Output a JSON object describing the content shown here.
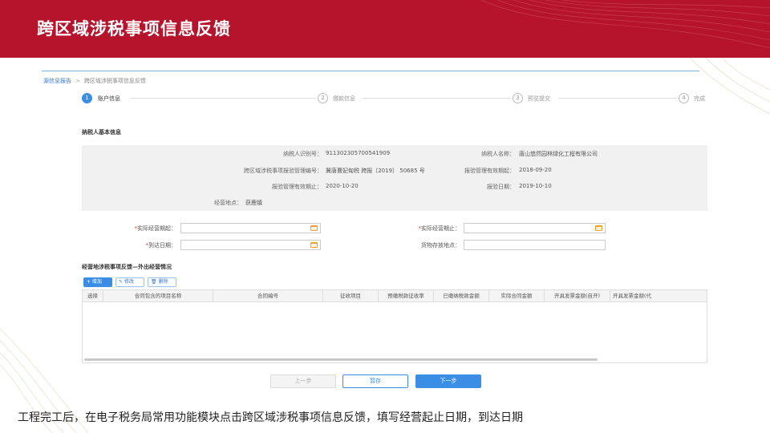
{
  "slide": {
    "title": "跨区域涉税事项信息反馈",
    "caption": "工程完工后，在电子税务局常用功能模块点击跨区域涉税事项信息反馈，填写经营起止日期，到达日期"
  },
  "breadcrumb": {
    "link": "源信息报告",
    "separator": ">",
    "current": "跨区域涉税事项信息反馈"
  },
  "steps": [
    {
      "num": "1",
      "label": "账户信息"
    },
    {
      "num": "2",
      "label": "缴款信息"
    },
    {
      "num": "3",
      "label": "预览提交"
    },
    {
      "num": "4",
      "label": "完成"
    }
  ],
  "taxpayer_section": {
    "title": "纳税人基本信息",
    "taxpayer_id_label": "纳税人识别号：",
    "taxpayer_id": "911302305700541909",
    "taxpayer_name_label": "纳税人名称：",
    "taxpayer_name": "唐山悠然园林绿化工程有限公司",
    "report_no_label": "跨区域涉税事项报验管理编号：",
    "report_no": "冀唐曹妃甸税 跨报〔2019〕 50685 号",
    "valid_from_label": "报验管理有效期起：",
    "valid_from": "2018-09-20",
    "valid_to_label": "报验管理有效期止：",
    "valid_to": "2020-10-20",
    "report_date_label": "报验日期：",
    "report_date": "2019-10-10",
    "location_label": "经营地点：",
    "location": "获鹿镇"
  },
  "form": {
    "start_label": "实际经营期起：",
    "end_label": "实际经营期止：",
    "arrival_label": "到达日期：",
    "storage_label": "货物存放地点：",
    "required_mark": "*"
  },
  "contract_section": {
    "title": "经营地涉税事项反馈—外出经营情况",
    "toolbar": {
      "add": "+ 增加",
      "edit": "修改",
      "delete": "删除"
    },
    "columns": [
      "选择",
      "合同包含的项目名称",
      "合同编号",
      "征收项目",
      "预缴税款征收率",
      "已缴纳税款金额",
      "实际合同金额",
      "开具发票金额(自开)",
      "开具发票金额(代"
    ]
  },
  "buttons": {
    "prev": "上一步",
    "save": "暂存",
    "next": "下一步"
  },
  "colors": {
    "banner": "#b5142c",
    "accent": "#3a8ee6",
    "required": "#e53935"
  }
}
